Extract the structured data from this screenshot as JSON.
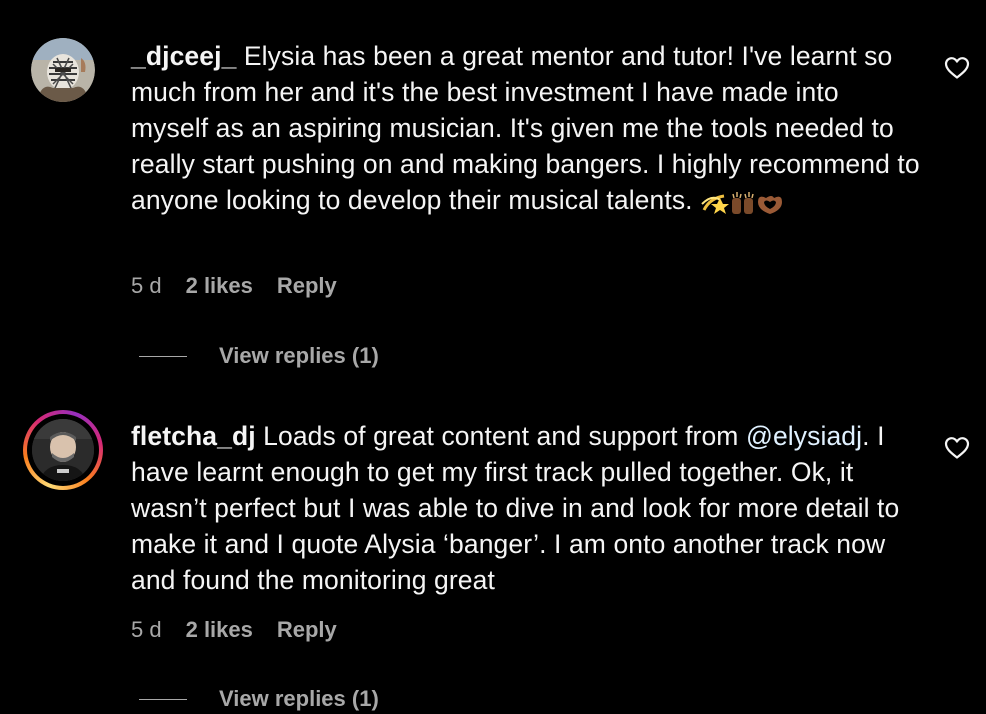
{
  "comments": [
    {
      "username": "_djceej_",
      "text": " Elysia has been a great mentor and tutor! I've learnt so much from her and it's the best investment I have made into myself as an aspiring musician. It's given me the tools needed to really start pushing on and making bangers. I highly recommend to anyone looking to develop their musical talents. ",
      "emoji": "💫🙌🏾🫶🏾",
      "time": "5 d",
      "likes": "2 likes",
      "reply": "Reply",
      "view_replies": "View replies (1)",
      "heart_icon": "heart-outline-icon",
      "avatar_story_ring": false
    },
    {
      "username": "fletcha_dj",
      "text_before_mention": " Loads of great content and support from ",
      "mention": "@elysiadj",
      "text_after_mention": ". I have learnt enough to get my first track pulled together. Ok, it wasn’t perfect but I was able to dive in and look for more detail to make it and I quote Alysia ‘banger’. I am onto another track now and found the monitoring great",
      "time": "5 d",
      "likes": "2 likes",
      "reply": "Reply",
      "view_replies": "View replies (1)",
      "heart_icon": "heart-outline-icon",
      "avatar_story_ring": true
    }
  ],
  "colors": {
    "background": "#000000",
    "primary_text": "#f5f5f5",
    "secondary_text": "#a8a8a8",
    "mention": "#e0f1ff"
  }
}
